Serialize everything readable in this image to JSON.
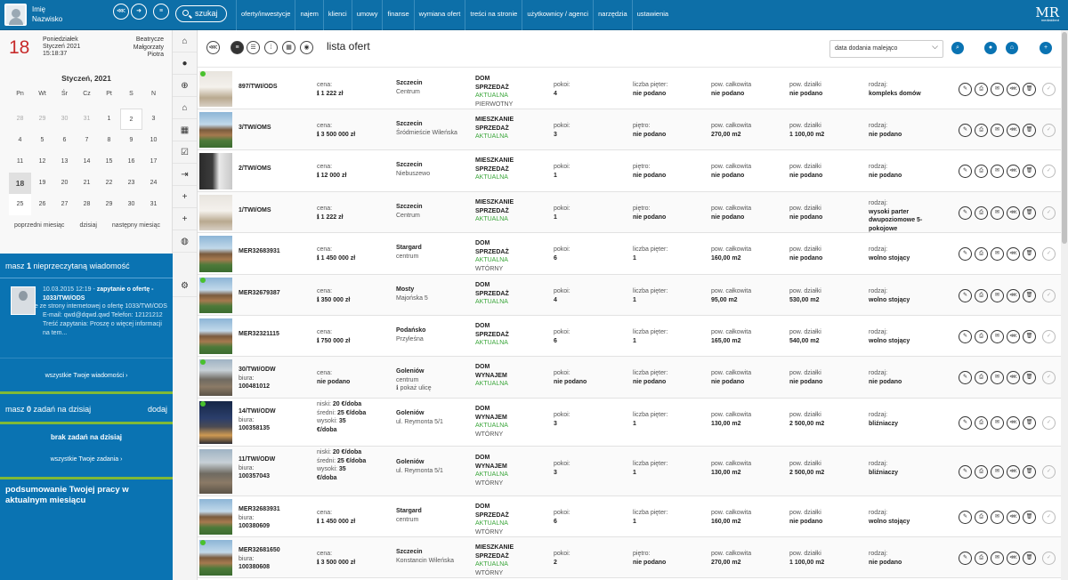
{
  "user": {
    "first": "Imię",
    "last": "Nazwisko"
  },
  "search_label": "szukaj",
  "nav": [
    "oferty/inwestycje",
    "najem",
    "klienci",
    "umowy",
    "finanse",
    "wymiana ofert",
    "treści na stronie",
    "użytkownicy / agenci",
    "narzędzia",
    "ustawienia"
  ],
  "logo": {
    "mark": "MR",
    "sub": "mediaklient"
  },
  "today": {
    "day": "18",
    "weekday": "Poniedziałek",
    "monthyear": "Styczeń 2021",
    "time": "15:18:37",
    "names": [
      "Beatrycze",
      "Małgorzaty",
      "Piotra"
    ]
  },
  "calendar": {
    "title": "Styczeń, 2021",
    "weekdays": [
      "Pn",
      "Wt",
      "Śr",
      "Cz",
      "Pt",
      "S",
      "N"
    ],
    "weeks": [
      [
        "28",
        "29",
        "30",
        "31",
        "1",
        "2",
        "3"
      ],
      [
        "4",
        "5",
        "6",
        "7",
        "8",
        "9",
        "10"
      ],
      [
        "11",
        "12",
        "13",
        "14",
        "15",
        "16",
        "17"
      ],
      [
        "18",
        "19",
        "20",
        "21",
        "22",
        "23",
        "24"
      ],
      [
        "25",
        "26",
        "27",
        "28",
        "29",
        "30",
        "31"
      ]
    ],
    "prev": "poprzedni miesiąc",
    "now": "dzisiaj",
    "next": "następny miesiąc"
  },
  "messages": {
    "header_pre": "masz ",
    "header_count": "1",
    "header_post": " nieprzeczytaną wiadomość",
    "item_date": "10.03.2015 12:19 - ",
    "item_title": "zapytanie o ofertę - 1033/TWI/ODS",
    "item_body": "Zapytanie ze strony internetowej o ofertę 1033/TWI/ODS E-mail: qwd@dqwd.qwd Telefon: 12121212 Treść zapytania: Proszę o więcej informacji na tem...",
    "all_link": "wszystkie Twoje wiadomości"
  },
  "tasks": {
    "header_pre": "masz ",
    "count": "0",
    "header_post": " zadań na dzisiaj",
    "add": "dodaj",
    "none": "brak zadań na dzisiaj",
    "all_link": "wszystkie Twoje zadania"
  },
  "summary": "podsumowanie Twojej pracy w aktualnym miesiącu",
  "list_title": "lista ofert",
  "sort_label": "data dodania malejąco",
  "labels": {
    "price": "cena:",
    "rooms": "pokoi:",
    "floors": "liczba pięter:",
    "floor": "piętro:",
    "area": "pow. całkowita",
    "plot": "pow. działki",
    "kind": "rodzaj:",
    "office": "biura:",
    "low": "niski:",
    "mid": "średni:",
    "high": "wysoki:"
  },
  "offers": [
    {
      "id": "897/TWI/ODS",
      "price": "1 222 zł",
      "city": "Szczecin",
      "district": "Centrum",
      "type": "DOM",
      "trans": "SPRZEDAŻ",
      "status": "AKTUALNA",
      "market": "PIERWOTNY",
      "rooms": "4",
      "flbl": "floors",
      "floors": "nie podano",
      "area": "nie podano",
      "plot": "nie podano",
      "kind": "kompleks domów",
      "thumb": "interior",
      "dot": true
    },
    {
      "id": "3/TWI/OMS",
      "price": "3 500 000 zł",
      "city": "Szczecin",
      "district": "Śródmieście Wileńska",
      "type": "MIESZKANIE",
      "trans": "SPRZEDAŻ",
      "status": "AKTUALNA",
      "market": "",
      "rooms": "3",
      "flbl": "floor",
      "floors": "nie podano",
      "area": "270,00 m2",
      "plot": "1 100,00 m2",
      "kind": "nie podano",
      "thumb": "house",
      "dot": false
    },
    {
      "id": "2/TWI/OMS",
      "price": "12 000 zł",
      "city": "Szczecin",
      "district": "Niebuszewo",
      "type": "MIESZKANIE",
      "trans": "SPRZEDAŻ",
      "status": "AKTUALNA",
      "market": "",
      "rooms": "1",
      "flbl": "floor",
      "floors": "nie podano",
      "area": "nie podano",
      "plot": "nie podano",
      "kind": "nie podano",
      "thumb": "kitchen",
      "dot": false
    },
    {
      "id": "1/TWI/OMS",
      "price": "1 222 zł",
      "city": "Szczecin",
      "district": "Centrum",
      "type": "MIESZKANIE",
      "trans": "SPRZEDAŻ",
      "status": "AKTUALNA",
      "market": "",
      "rooms": "1",
      "flbl": "floor",
      "floors": "nie podano",
      "area": "nie podano",
      "plot": "nie podano",
      "kind": "wysoki parter dwupoziomowe 5-pokojowe",
      "thumb": "interior",
      "dot": false
    },
    {
      "id": "MER32683931",
      "price": "1 450 000 zł",
      "city": "Stargard",
      "district": "centrum",
      "type": "DOM",
      "trans": "SPRZEDAŻ",
      "status": "AKTUALNA",
      "market": "WTÓRNY",
      "rooms": "6",
      "flbl": "floors",
      "floors": "1",
      "area": "160,00 m2",
      "plot": "nie podano",
      "kind": "wolno stojący",
      "thumb": "house",
      "dot": false
    },
    {
      "id": "MER32679387",
      "price": "350 000 zł",
      "city": "Mosty",
      "district": "Majońska 5",
      "type": "DOM",
      "trans": "SPRZEDAŻ",
      "status": "AKTUALNA",
      "market": "",
      "rooms": "4",
      "flbl": "floors",
      "floors": "1",
      "area": "95,00 m2",
      "plot": "530,00 m2",
      "kind": "wolno stojący",
      "thumb": "house",
      "dot": true
    },
    {
      "id": "MER32321115",
      "price": "750 000 zł",
      "city": "Podańsko",
      "district": "Przyleśna",
      "type": "DOM",
      "trans": "SPRZEDAŻ",
      "status": "AKTUALNA",
      "market": "",
      "rooms": "6",
      "flbl": "floors",
      "floors": "1",
      "area": "165,00 m2",
      "plot": "540,00 m2",
      "kind": "wolno stojący",
      "thumb": "house",
      "dot": false
    },
    {
      "id": "30/TWI/ODW",
      "office": "100481012",
      "price": "nie podano",
      "city": "Goleniów",
      "district": "centrum",
      "street": "pokaż ulicę",
      "type": "DOM",
      "trans": "WYNAJEM",
      "status": "AKTUALNA",
      "market": "",
      "rooms": "nie podano",
      "flbl": "floors",
      "floors": "nie podano",
      "area": "nie podano",
      "plot": "nie podano",
      "kind": "nie podano",
      "thumb": "city",
      "dot": true
    },
    {
      "id": "14/TWI/ODW",
      "office": "100358135",
      "seasonal": true,
      "low": "20 €/doba",
      "mid": "25 €/doba",
      "high": "35 €/doba",
      "city": "Goleniów",
      "district": "ul. Reymonta 5/1",
      "type": "DOM",
      "trans": "WYNAJEM",
      "status": "AKTUALNA",
      "market": "WTÓRNY",
      "rooms": "3",
      "flbl": "floors",
      "floors": "1",
      "area": "130,00 m2",
      "plot": "2 500,00 m2",
      "kind": "bliźniaczy",
      "thumb": "citynight",
      "dot": true
    },
    {
      "id": "11/TWI/ODW",
      "office": "100357043",
      "seasonal": true,
      "low": "20 €/doba",
      "mid": "25 €/doba",
      "high": "35 €/doba",
      "city": "Goleniów",
      "district": "ul. Reymonta 5/1",
      "type": "DOM",
      "trans": "WYNAJEM",
      "status": "AKTUALNA",
      "market": "WTÓRNY",
      "rooms": "3",
      "flbl": "floors",
      "floors": "1",
      "area": "130,00 m2",
      "plot": "2 500,00 m2",
      "kind": "bliźniaczy",
      "thumb": "city",
      "dot": false
    },
    {
      "id": "MER32683931",
      "office": "100380609",
      "price": "1 450 000 zł",
      "city": "Stargard",
      "district": "centrum",
      "type": "DOM",
      "trans": "SPRZEDAŻ",
      "status": "AKTUALNA",
      "market": "WTÓRNY",
      "rooms": "6",
      "flbl": "floors",
      "floors": "1",
      "area": "160,00 m2",
      "plot": "nie podano",
      "kind": "wolno stojący",
      "thumb": "house",
      "dot": false
    },
    {
      "id": "MER32681650",
      "office": "100380608",
      "price": "3 500 000 zł",
      "city": "Szczecin",
      "district": "Konstancin Wileńska",
      "type": "MIESZKANIE",
      "trans": "SPRZEDAŻ",
      "status": "AKTUALNA",
      "market": "WTÓRNY",
      "rooms": "2",
      "flbl": "floor",
      "floors": "nie podano",
      "area": "270,00 m2",
      "plot": "1 100,00 m2",
      "kind": "nie podano",
      "thumb": "house",
      "dot": true
    }
  ]
}
